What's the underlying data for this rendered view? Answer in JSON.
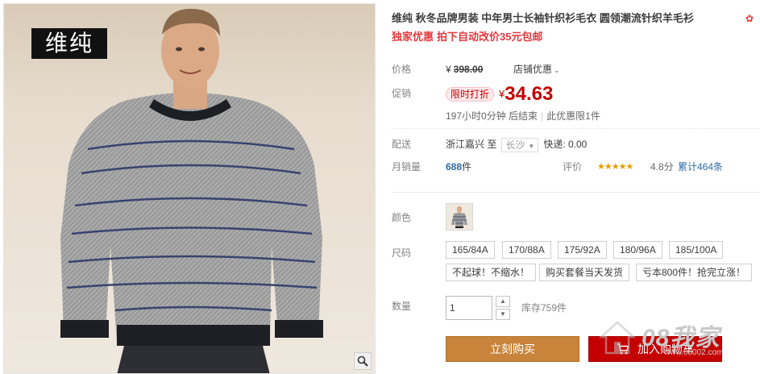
{
  "gallery": {
    "brand_logo_text": "维纯",
    "zoom_icon": "magnifier-icon"
  },
  "product": {
    "title": "维纯 秋冬品牌男装 中年男士长袖针织衫毛衣 圆领潮流针织羊毛衫",
    "promo_a": "独家优惠",
    "promo_b": "拍下自动改价35元包邮"
  },
  "price": {
    "label": "价格",
    "currency": "¥",
    "original": "398.00",
    "shop_coupon": "店铺优惠"
  },
  "promotion": {
    "label": "促销",
    "tag": "限时打折",
    "currency": "¥",
    "price": "34.63",
    "countdown": "197小时0分钟 后结束",
    "limit": "此优惠限1件"
  },
  "shipping": {
    "label": "配送",
    "origin": "浙江嘉兴",
    "to": "至",
    "city": "长沙",
    "fee": "快递: 0.00"
  },
  "sales": {
    "label": "月销量",
    "count": "688",
    "unit": "件",
    "rating_label": "评价",
    "stars": "★★★★★",
    "score": "4.8分",
    "reviews": "累计464条"
  },
  "color": {
    "label": "颜色"
  },
  "size": {
    "label": "尺码",
    "options": [
      "165/84A",
      "170/88A",
      "175/92A",
      "180/96A",
      "185/100A"
    ],
    "extra_options": [
      "不起球！不缩水！",
      "购买套餐当天发货",
      "亏本800件！抢完立涨！"
    ]
  },
  "quantity": {
    "label": "数量",
    "value": "1",
    "stock": "库存759件"
  },
  "actions": {
    "buy_now": "立刻购买",
    "add_to_cart": "加入购物车"
  },
  "watermark": {
    "text": "08我家",
    "url": "www.08002.com"
  },
  "colors": {
    "price_red": "#c40000",
    "promo_red": "#e4393c",
    "buy_orange": "#c8843a",
    "link_blue": "#2c6aa8"
  }
}
